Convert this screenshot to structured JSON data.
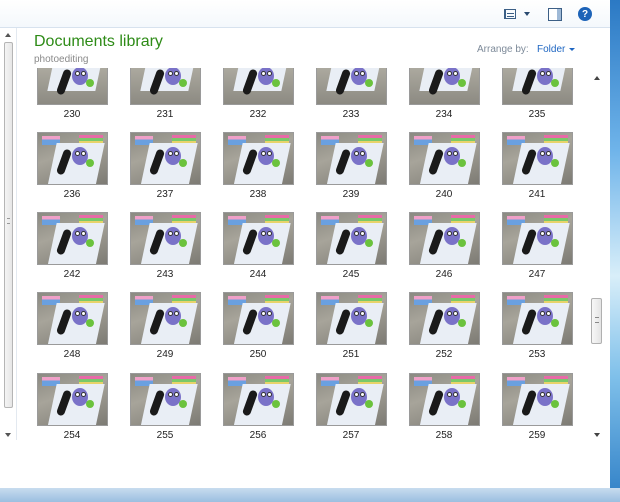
{
  "toolbar": {
    "views_icon": "change-view-icon",
    "preview_icon": "preview-pane-icon",
    "help_icon": "help-icon",
    "help_glyph": "?"
  },
  "library": {
    "title": "Documents library",
    "subtitle": "photoediting"
  },
  "arrange": {
    "label": "Arrange by:",
    "value": "Folder"
  },
  "items": [
    {
      "name": "230"
    },
    {
      "name": "231"
    },
    {
      "name": "232"
    },
    {
      "name": "233"
    },
    {
      "name": "234"
    },
    {
      "name": "235"
    },
    {
      "name": "236"
    },
    {
      "name": "237"
    },
    {
      "name": "238"
    },
    {
      "name": "239"
    },
    {
      "name": "240"
    },
    {
      "name": "241"
    },
    {
      "name": "242"
    },
    {
      "name": "243"
    },
    {
      "name": "244"
    },
    {
      "name": "245"
    },
    {
      "name": "246"
    },
    {
      "name": "247"
    },
    {
      "name": "248"
    },
    {
      "name": "249"
    },
    {
      "name": "250"
    },
    {
      "name": "251"
    },
    {
      "name": "252"
    },
    {
      "name": "253"
    },
    {
      "name": "254"
    },
    {
      "name": "255"
    },
    {
      "name": "256"
    },
    {
      "name": "257"
    },
    {
      "name": "258"
    },
    {
      "name": "259"
    }
  ]
}
